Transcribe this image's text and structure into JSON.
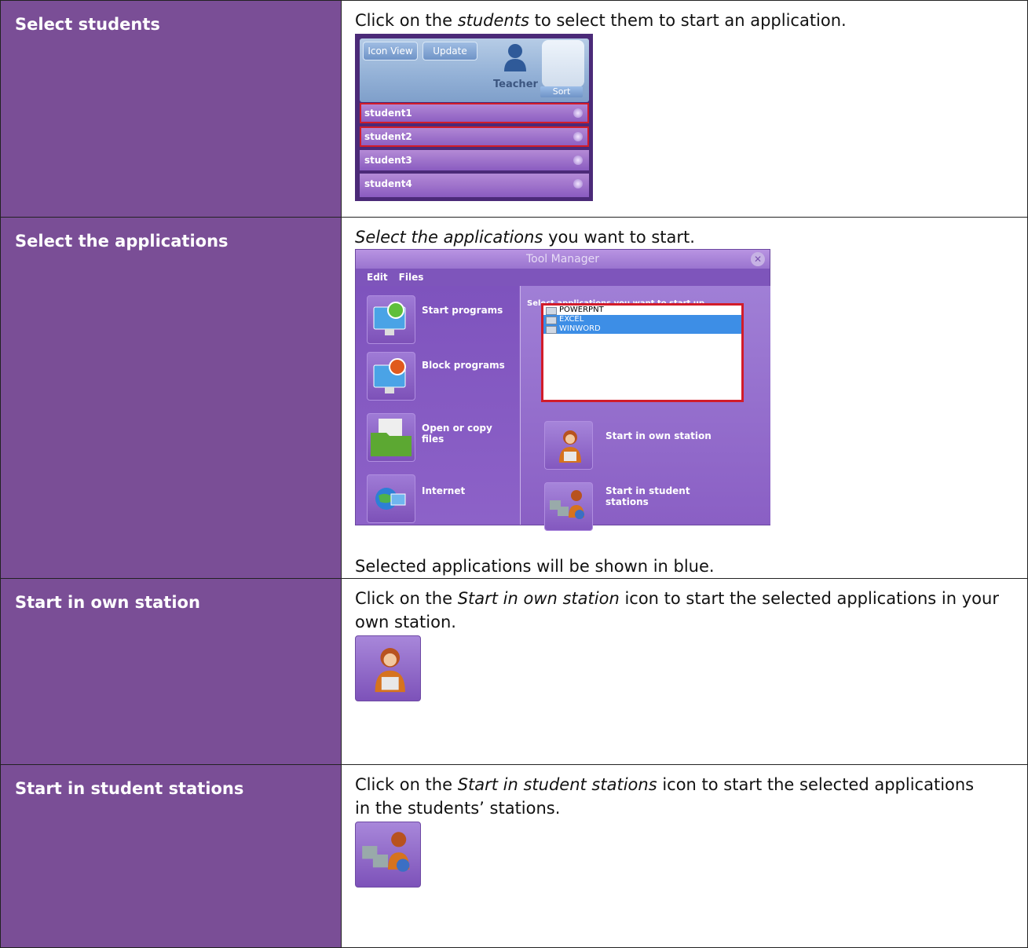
{
  "rows": [
    {
      "label": "Select students",
      "text_1": "Click on the ",
      "text_it": "students",
      "text_2": " to select them to start an application.",
      "screenshot": {
        "buttons": [
          "Icon View",
          "Update"
        ],
        "teacher": "Teacher",
        "sort": "Sort",
        "students": [
          "student1",
          "student2",
          "student3",
          "student4"
        ]
      }
    },
    {
      "label": "Select the applications",
      "text_it": "Select the applications",
      "text_2": " you want to start.",
      "note": "Selected applications will be shown in blue.",
      "screenshot": {
        "title": "Tool Manager",
        "menu": [
          "Edit",
          "Files"
        ],
        "tools": [
          "Start programs",
          "Block programs",
          "Open or copy files",
          "Internet"
        ],
        "list_header": "Select applications you want to start up",
        "apps": [
          "POWERPNT",
          "EXCEL",
          "WINWORD"
        ],
        "actions": [
          "Start in own station",
          "Start in student stations"
        ]
      }
    },
    {
      "label": "Start in own station",
      "text_1": "Click on the ",
      "text_it": "Start in own station",
      "text_2": " icon to start the selected applications in your own station."
    },
    {
      "label": "Start in student stations",
      "text_1": "Click on the ",
      "text_it": "Start in student stations",
      "text_2": " icon to start the selected applications in the students’ stations."
    }
  ],
  "colors": {
    "label_bg": "#7a4e96",
    "selection_outline": "#d21c2a",
    "selected_app": "#3d8ee6"
  }
}
